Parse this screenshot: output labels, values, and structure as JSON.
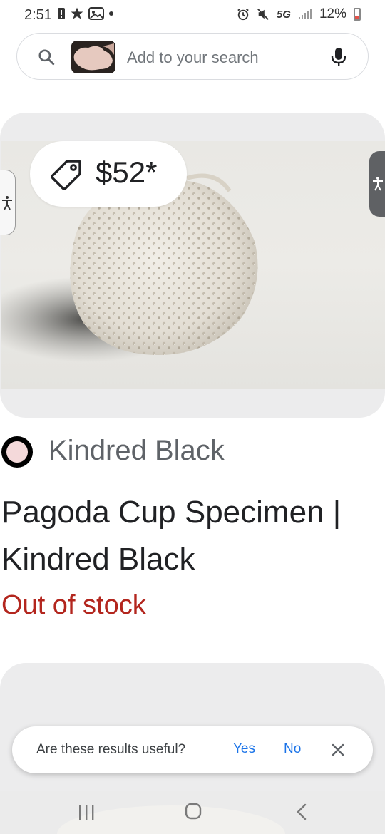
{
  "status_bar": {
    "time": "2:51",
    "network": "5G",
    "battery": "12%"
  },
  "search": {
    "placeholder": "Add to your search"
  },
  "product": {
    "price": "$52*",
    "merchant": "Kindred Black",
    "title": "Pagoda Cup Specimen | Kindred Black",
    "stock": "Out of stock"
  },
  "feedback": {
    "question": "Are these results useful?",
    "yes_label": "Yes",
    "no_label": "No"
  },
  "colors": {
    "accent": "#1a73e8",
    "out_of_stock": "#b3261e",
    "card_bg": "#ececed"
  },
  "icons": [
    "search-icon",
    "mic-icon",
    "tag-icon",
    "accessibility-icon",
    "close-icon",
    "recents-icon",
    "home-icon",
    "back-icon"
  ]
}
